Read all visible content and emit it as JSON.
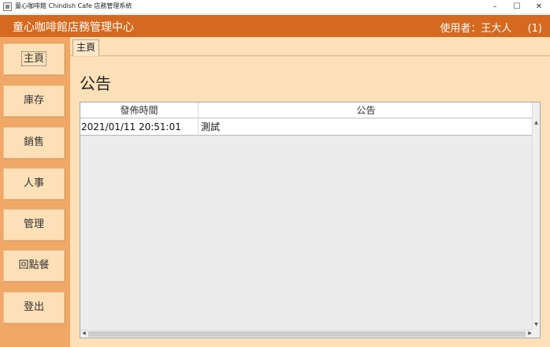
{
  "window": {
    "title": "童心咖啡館 Chindish Cafe 店務管理系統",
    "controls": {
      "minimize": "–",
      "maximize": "☐",
      "close": "✕"
    }
  },
  "header": {
    "title": "童心咖啡館店務管理中心",
    "user_label": "使用者：王大人",
    "user_badge": "(1)"
  },
  "sidebar": {
    "items": [
      {
        "label": "主頁"
      },
      {
        "label": "庫存"
      },
      {
        "label": "銷售"
      },
      {
        "label": "人事"
      },
      {
        "label": "管理"
      },
      {
        "label": "回點餐"
      },
      {
        "label": "登出"
      }
    ]
  },
  "tabs": [
    {
      "label": "主頁"
    }
  ],
  "main": {
    "title": "公告",
    "table": {
      "columns": [
        "發佈時間",
        "公告"
      ],
      "rows": [
        [
          "2021/01/11  20:51:01",
          "測試"
        ]
      ]
    }
  },
  "colors": {
    "header": "#d4691f",
    "sidebar": "#f1a766",
    "panel": "#fde0b8"
  }
}
